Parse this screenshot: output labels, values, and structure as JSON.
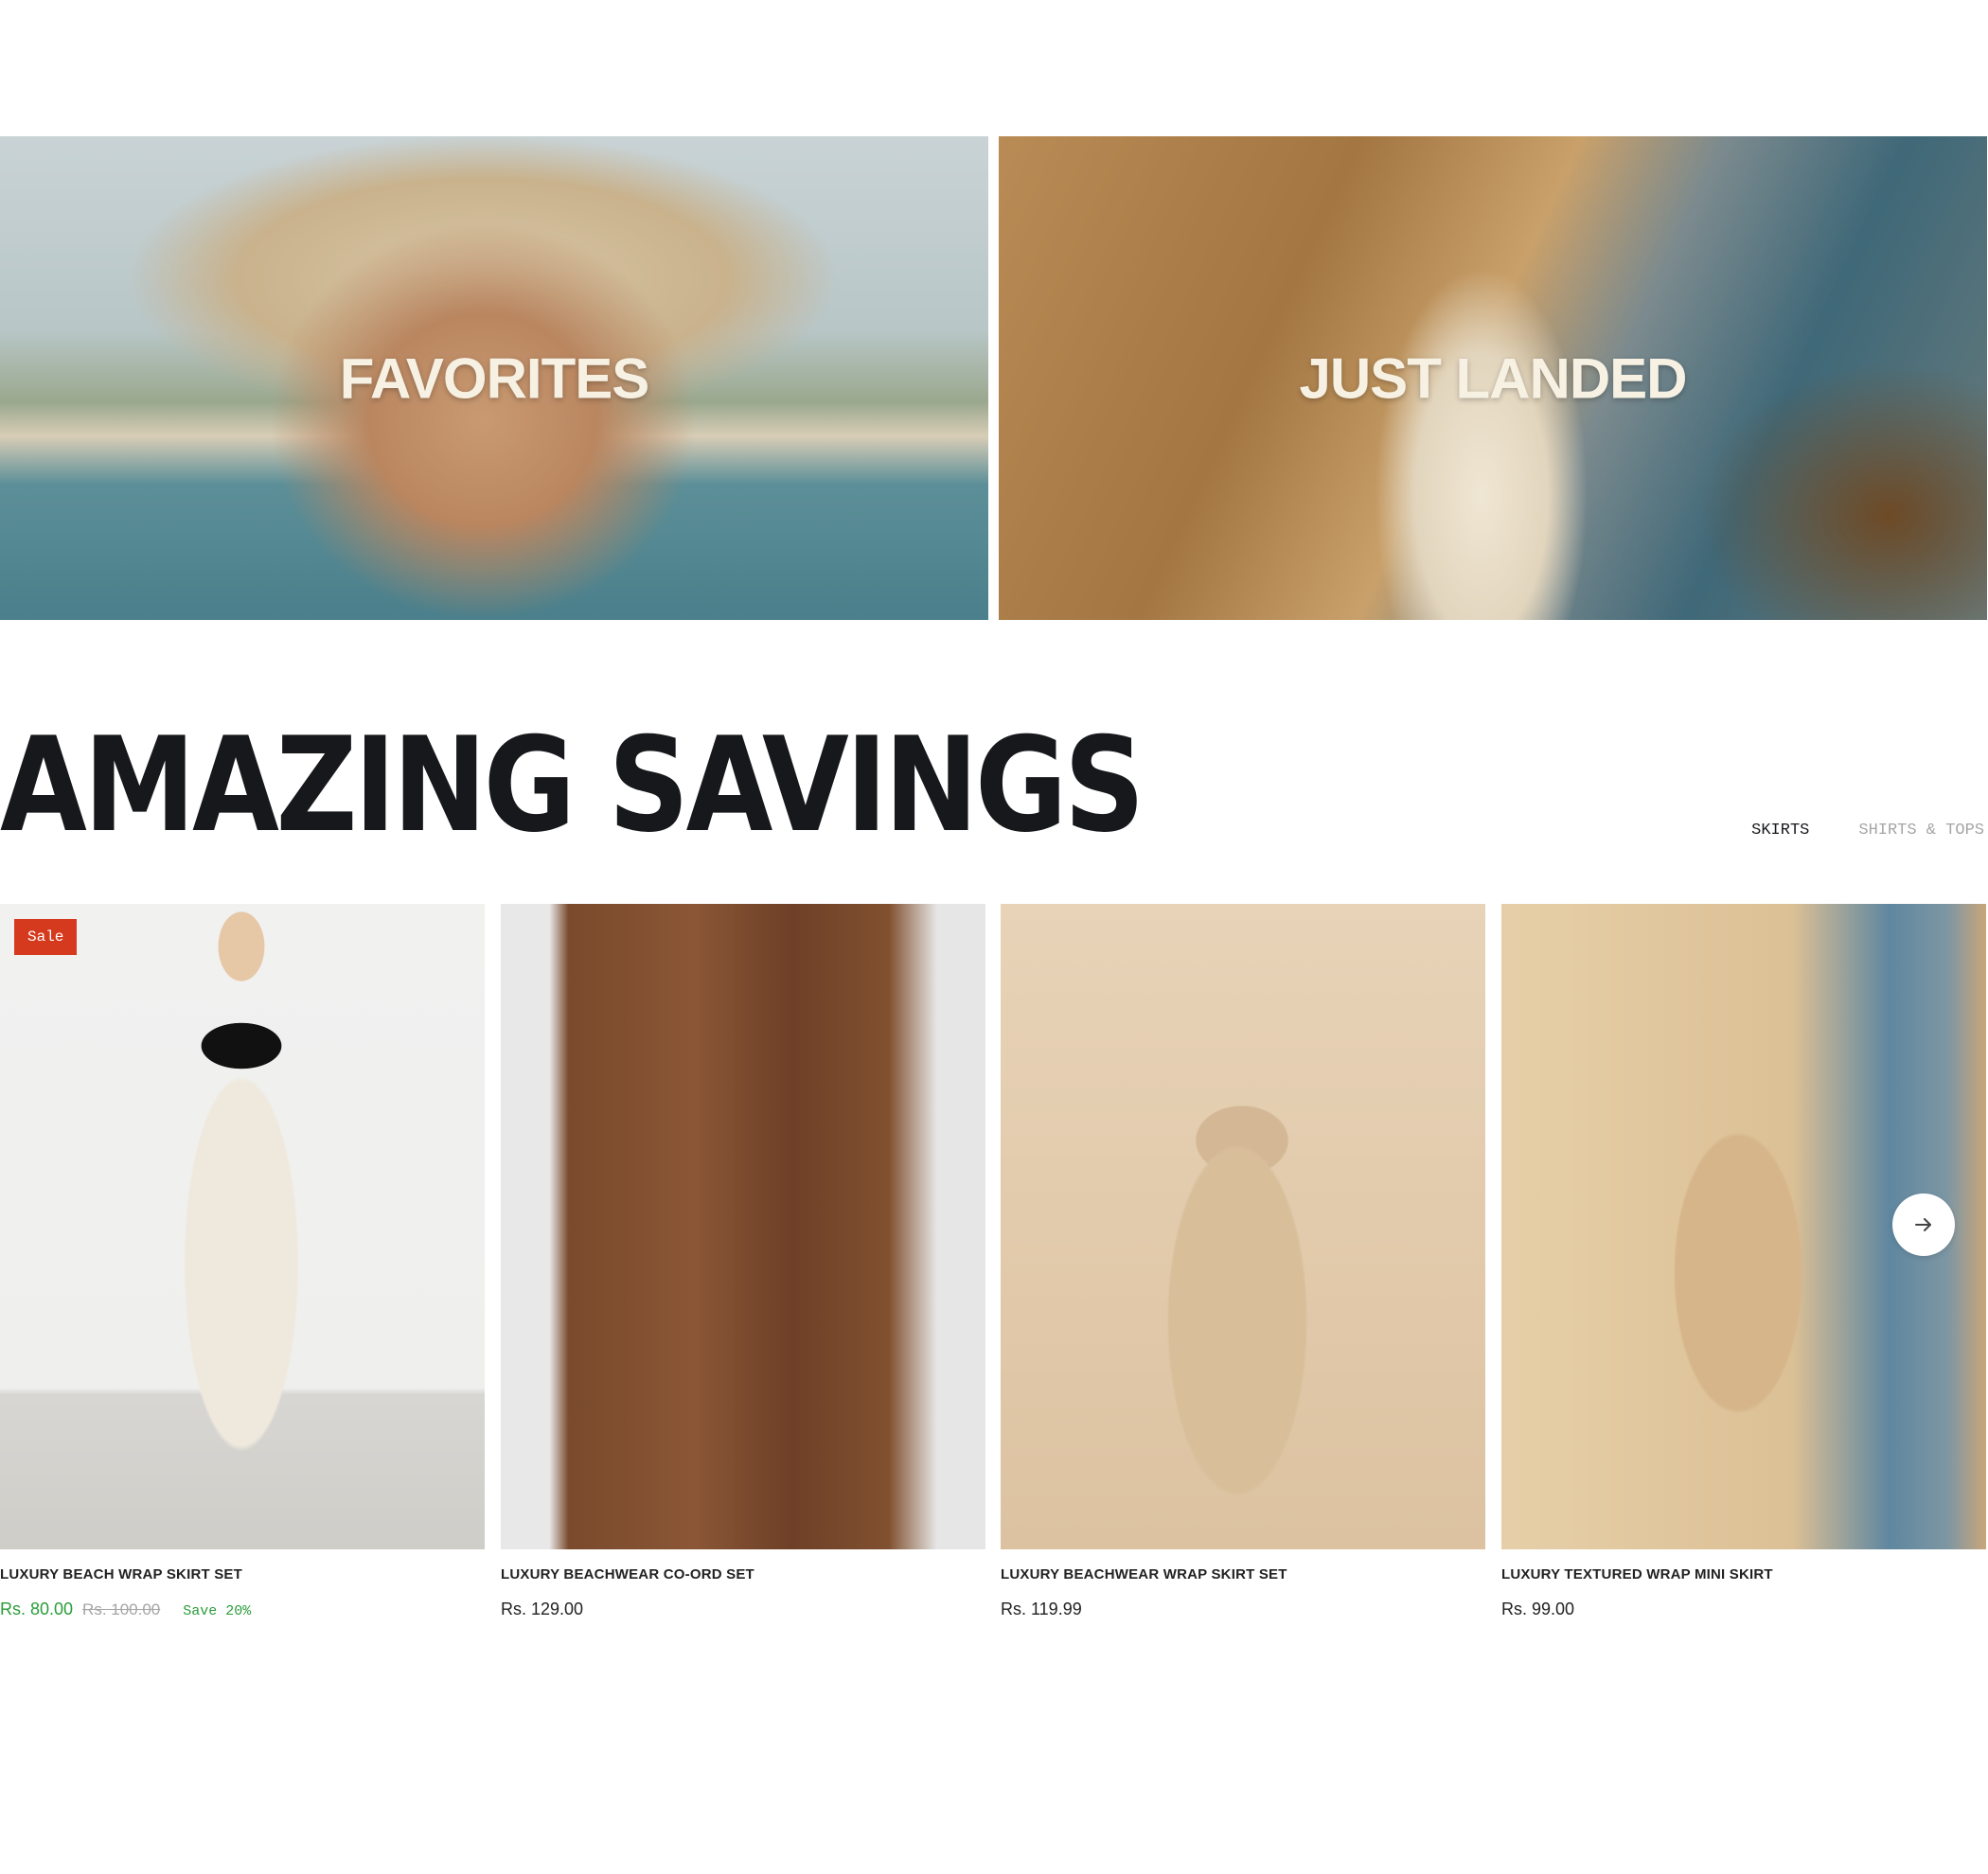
{
  "banners": [
    {
      "title": "FAVORITES"
    },
    {
      "title": "JUST LANDED"
    }
  ],
  "section": {
    "title": "AMAZING SAVINGS",
    "tabs": [
      {
        "label": "SKIRTS",
        "active": true
      },
      {
        "label": "SHIRTS & TOPS",
        "active": false
      }
    ]
  },
  "products": [
    {
      "title": "LUXURY BEACH WRAP SKIRT SET",
      "price": "Rs. 80.00",
      "compare_price": "Rs. 100.00",
      "save": "Save 20%",
      "badge": "Sale"
    },
    {
      "title": "LUXURY BEACHWEAR CO-ORD SET",
      "price": "Rs. 129.00"
    },
    {
      "title": "LUXURY BEACHWEAR WRAP SKIRT SET",
      "price": "Rs. 119.99"
    },
    {
      "title": "LUXURY TEXTURED WRAP MINI SKIRT",
      "price": "Rs. 99.00"
    }
  ],
  "colors": {
    "sale_badge": "#d63a1e",
    "sale_price": "#2a9d3a",
    "title_text": "#17181b"
  },
  "icons": {
    "carousel_next": "arrow-right-icon"
  }
}
